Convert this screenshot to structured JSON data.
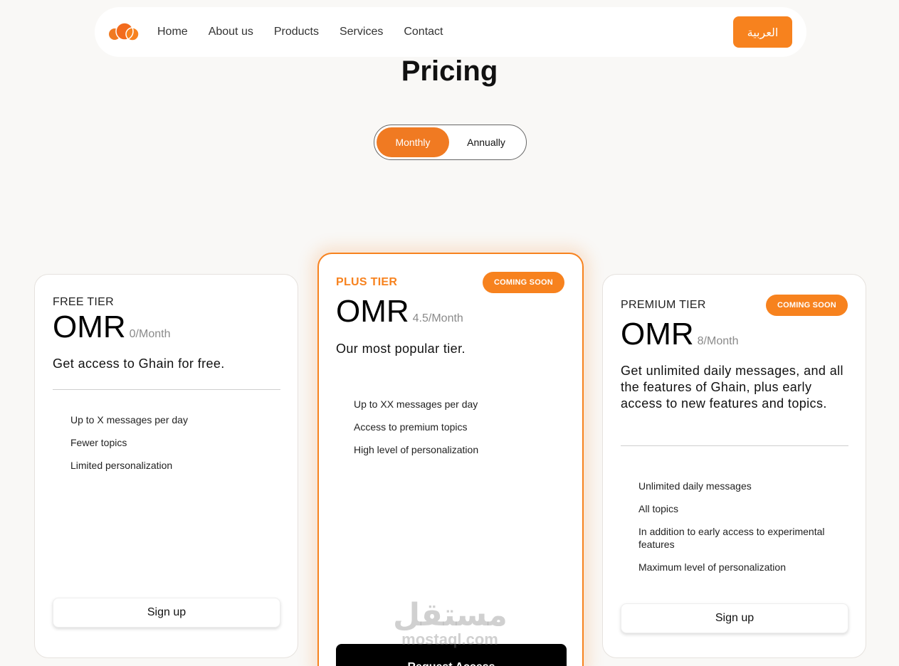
{
  "nav": {
    "links": [
      "Home",
      "About us",
      "Products",
      "Services",
      "Contact"
    ],
    "lang_button": "العربية"
  },
  "heading": "Pricing",
  "toggle": {
    "monthly": "Monthly",
    "annually": "Annually",
    "selected": "Monthly"
  },
  "cards": {
    "free": {
      "tier": "FREE TIER",
      "currency": "OMR",
      "period": "0/Month",
      "description": "Get access to Ghain for free.",
      "features": [
        "Up to X messages per day",
        "Fewer topics",
        "Limited personalization"
      ],
      "cta": "Sign up"
    },
    "plus": {
      "tier": "PLUS TIER",
      "badge": "COMING SOON",
      "currency": "OMR",
      "period": "4.5/Month",
      "description": "Our most popular tier.",
      "features": [
        "Up to XX messages per day",
        "Access to premium topics",
        "High level of personalization"
      ],
      "cta": "Request Access"
    },
    "premium": {
      "tier": "PREMIUM TIER",
      "badge": "COMING SOON",
      "currency": "OMR",
      "period": "8/Month",
      "description": "Get unlimited daily messages, and all the features of Ghain, plus early access to new features and topics.",
      "features": [
        "Unlimited daily messages",
        "All topics",
        "In addition to early access to experimental features",
        "Maximum level of personalization"
      ],
      "cta": "Sign up"
    }
  },
  "watermark": {
    "arabic": "مستقل",
    "latin": "mostaql.com"
  },
  "colors": {
    "accent": "#f7821e",
    "background": "#f9f8f6"
  }
}
